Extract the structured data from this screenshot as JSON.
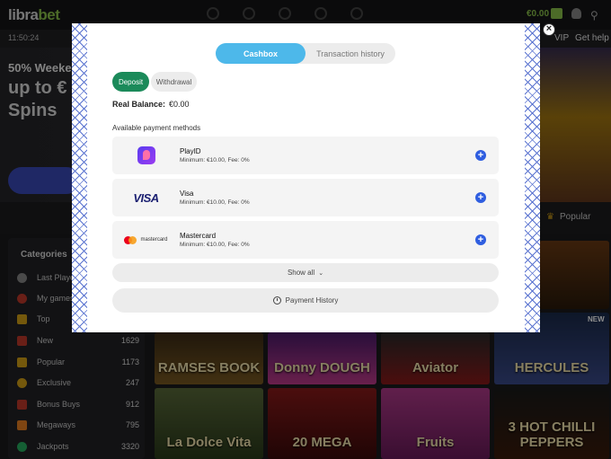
{
  "header": {
    "logo_prefix": "libra",
    "logo_suffix": "bet",
    "balance": "€0.00",
    "time": "11:50:24",
    "vip": "VIP",
    "get_help": "Get help"
  },
  "hero": {
    "line1": "50% Weeken",
    "line2": "up to €",
    "line3": "Spins"
  },
  "tabs": {
    "popular": "Popular"
  },
  "sidebar": {
    "title": "Categories",
    "items": [
      {
        "label": "Last Playe",
        "count": ""
      },
      {
        "label": "My games",
        "count": ""
      },
      {
        "label": "Top",
        "count": ""
      },
      {
        "label": "New",
        "count": "1629"
      },
      {
        "label": "Popular",
        "count": "1173"
      },
      {
        "label": "Exclusive",
        "count": "247"
      },
      {
        "label": "Bonus Buys",
        "count": "912"
      },
      {
        "label": "Megaways",
        "count": "795"
      },
      {
        "label": "Jackpots",
        "count": "3320"
      }
    ]
  },
  "games": {
    "new_badge": "NEW",
    "tiles": [
      "RAMSES BOOK",
      "Donny DOUGH",
      "Aviator",
      "HERCULES",
      "La Dolce Vita",
      "20 MEGA",
      "Fruits",
      "3 HOT CHILLI PEPPERS"
    ]
  },
  "modal": {
    "tab_cashbox": "Cashbox",
    "tab_history": "Transaction history",
    "pill_deposit": "Deposit",
    "pill_withdrawal": "Withdrawal",
    "balance_label": "Real Balance:",
    "balance_value": "€0.00",
    "methods_title": "Available payment methods",
    "methods": [
      {
        "name": "PlayID",
        "desc": "Minimum: €10.00, Fee: 0%"
      },
      {
        "name": "Visa",
        "desc": "Minimum: €10.00, Fee: 0%",
        "logo_text": "VISA"
      },
      {
        "name": "Mastercard",
        "desc": "Minimum: €10.00, Fee: 0%",
        "logo_text": "mastercard"
      }
    ],
    "show_all": "Show all",
    "payment_history": "Payment History",
    "close_glyph": "×",
    "add_glyph": "+",
    "chevron_glyph": "⌄"
  },
  "colors": {
    "accent_blue": "#4db8ea",
    "deposit_green": "#1b8a5a",
    "add_button": "#2f5ee0",
    "brand_green": "#8bc34a"
  }
}
